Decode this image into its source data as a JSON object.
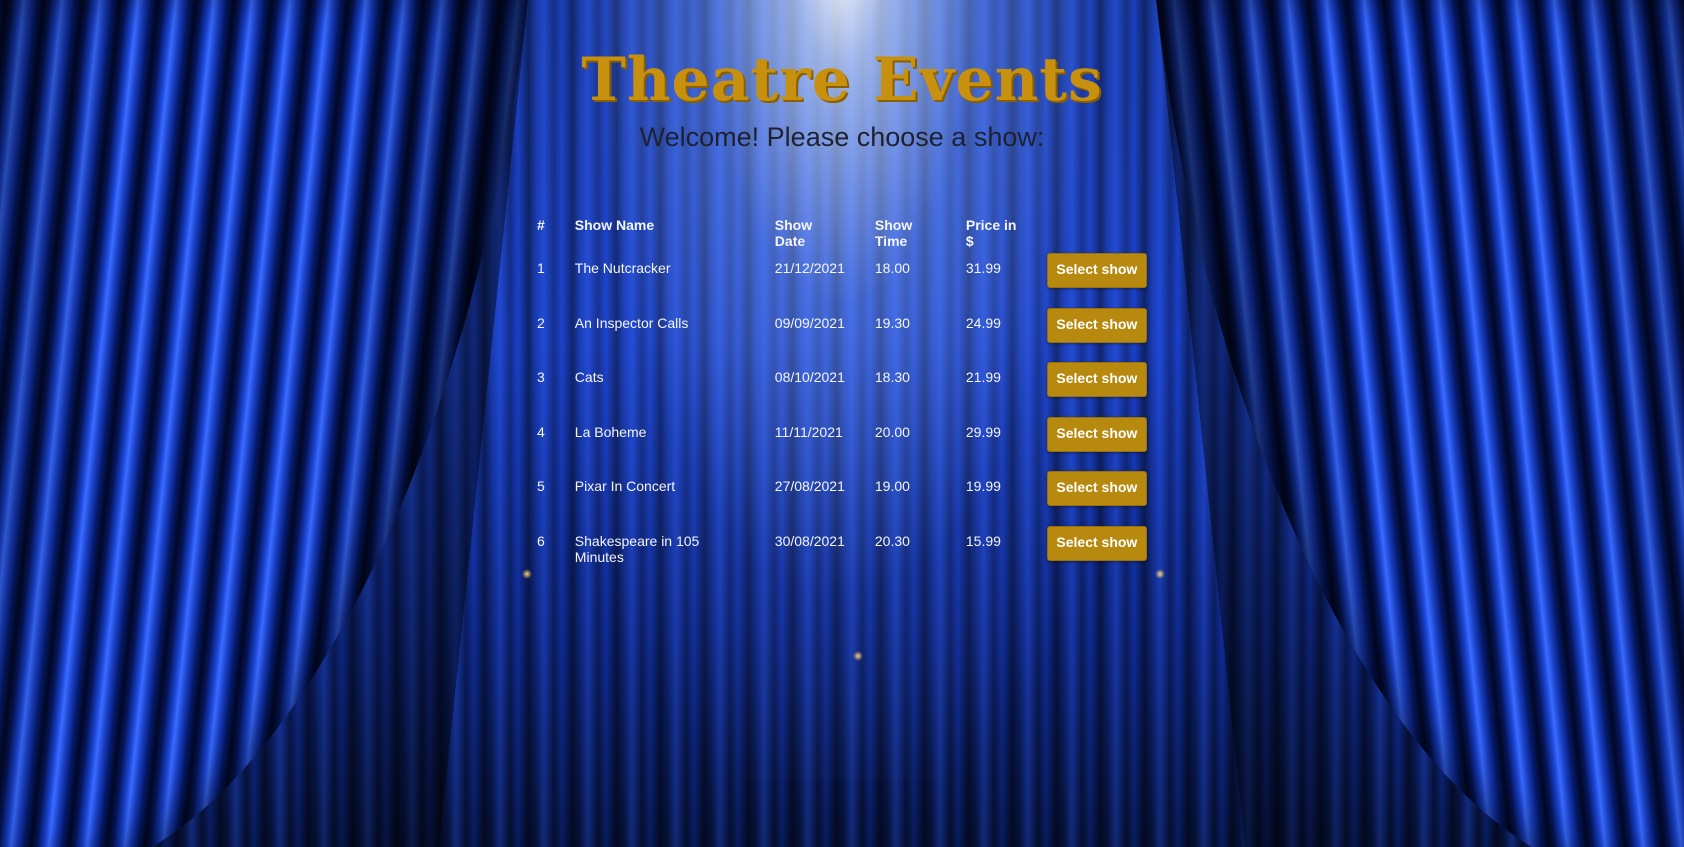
{
  "page": {
    "title": "Theatre Events",
    "subtitle": "Welcome! Please choose a show:"
  },
  "table": {
    "headers": [
      "#",
      "Show Name",
      "Show Date",
      "Show Time",
      "Price in $",
      ""
    ],
    "rows": [
      {
        "num": "1",
        "name": "The Nutcracker",
        "date": "21/12/2021",
        "time": "18.00",
        "price": "31.99",
        "action": "Select show"
      },
      {
        "num": "2",
        "name": "An Inspector Calls",
        "date": "09/09/2021",
        "time": "19.30",
        "price": "24.99",
        "action": "Select show"
      },
      {
        "num": "3",
        "name": "Cats",
        "date": "08/10/2021",
        "time": "18.30",
        "price": "21.99",
        "action": "Select show"
      },
      {
        "num": "4",
        "name": "La Boheme",
        "date": "11/11/2021",
        "time": "20.00",
        "price": "29.99",
        "action": "Select show"
      },
      {
        "num": "5",
        "name": "Pixar In Concert",
        "date": "27/08/2021",
        "time": "19.00",
        "price": "19.99",
        "action": "Select show"
      },
      {
        "num": "6",
        "name": "Shakespeare in 105 Minutes",
        "date": "30/08/2021",
        "time": "20.30",
        "price": "15.99",
        "action": "Select show"
      }
    ]
  },
  "colors": {
    "title": "#c8900f",
    "button": "#b8890f",
    "text": "#f3f5ff",
    "subtitle": "#1d2130",
    "curtain": "#1b46d8"
  },
  "background": "blue-theatre-curtain"
}
